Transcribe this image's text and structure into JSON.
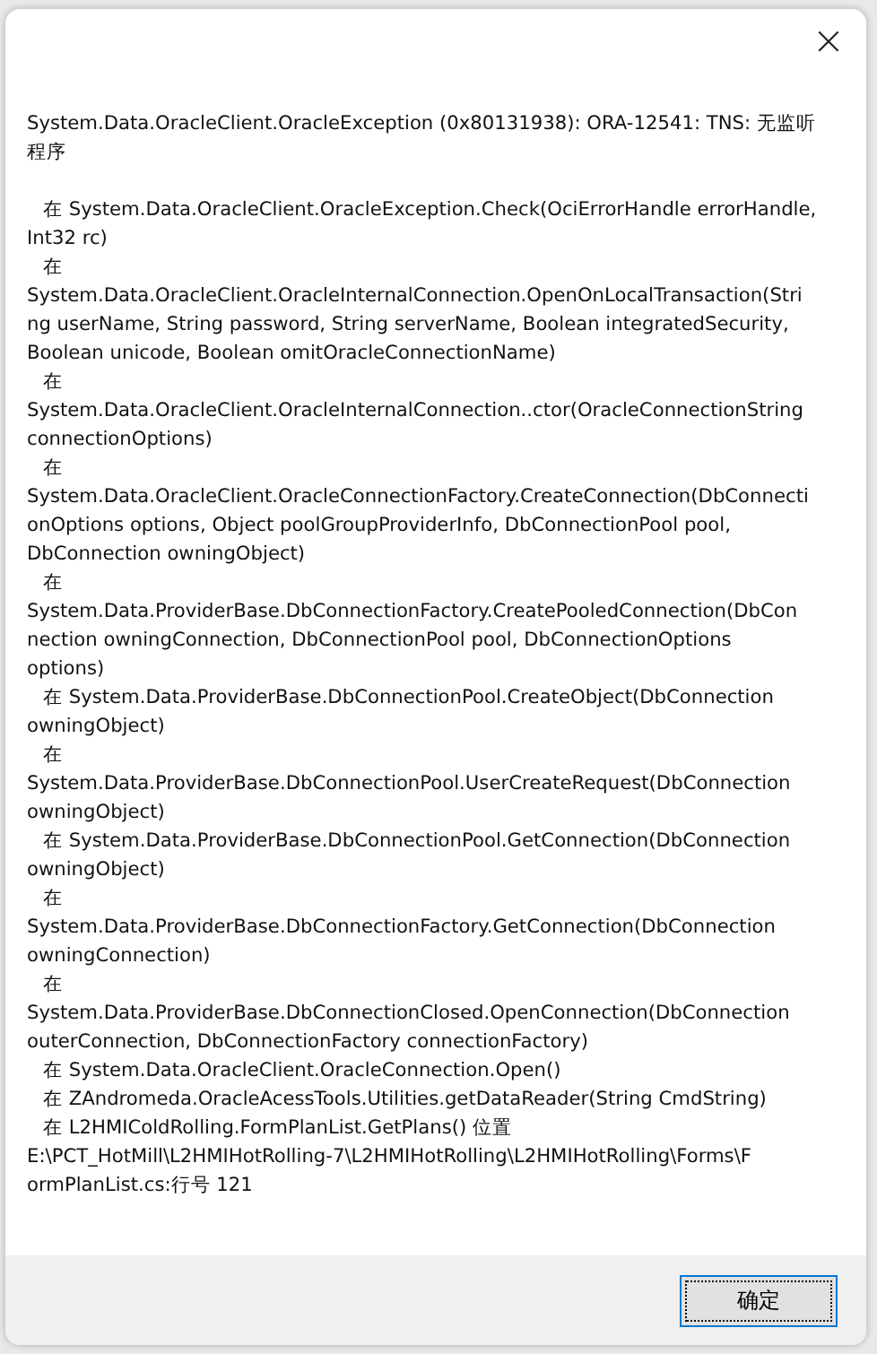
{
  "dialog": {
    "close_label": "×",
    "header_lines": [
      "System.Data.OracleClient.OracleException (0x80131938): ORA-12541: TNS: 无监听",
      "程序"
    ],
    "frames": [
      {
        "lines": [
          "在 System.Data.OracleClient.OracleException.Check(OciErrorHandle errorHandle,",
          "Int32 rc)"
        ]
      },
      {
        "lines": [
          "在",
          "System.Data.OracleClient.OracleInternalConnection.OpenOnLocalTransaction(Stri",
          "ng userName, String password, String serverName, Boolean integratedSecurity,",
          "Boolean unicode, Boolean omitOracleConnectionName)"
        ]
      },
      {
        "lines": [
          "在",
          "System.Data.OracleClient.OracleInternalConnection..ctor(OracleConnectionString",
          "connectionOptions)"
        ]
      },
      {
        "lines": [
          "在",
          "System.Data.OracleClient.OracleConnectionFactory.CreateConnection(DbConnecti",
          "onOptions options, Object poolGroupProviderInfo, DbConnectionPool pool,",
          "DbConnection owningObject)"
        ]
      },
      {
        "lines": [
          "在",
          "System.Data.ProviderBase.DbConnectionFactory.CreatePooledConnection(DbCon",
          "nection owningConnection, DbConnectionPool pool, DbConnectionOptions",
          "options)"
        ]
      },
      {
        "lines": [
          "在 System.Data.ProviderBase.DbConnectionPool.CreateObject(DbConnection",
          "owningObject)"
        ]
      },
      {
        "lines": [
          "在",
          "System.Data.ProviderBase.DbConnectionPool.UserCreateRequest(DbConnection",
          "owningObject)"
        ]
      },
      {
        "lines": [
          "在 System.Data.ProviderBase.DbConnectionPool.GetConnection(DbConnection",
          "owningObject)"
        ]
      },
      {
        "lines": [
          "在",
          "System.Data.ProviderBase.DbConnectionFactory.GetConnection(DbConnection",
          "owningConnection)"
        ]
      },
      {
        "lines": [
          "在",
          "System.Data.ProviderBase.DbConnectionClosed.OpenConnection(DbConnection",
          "outerConnection, DbConnectionFactory connectionFactory)"
        ]
      },
      {
        "lines": [
          "在 System.Data.OracleClient.OracleConnection.Open()"
        ]
      },
      {
        "lines": [
          "在 ZAndromeda.OracleAcessTools.Utilities.getDataReader(String CmdString)"
        ]
      },
      {
        "lines": [
          "在 L2HMIColdRolling.FormPlanList.GetPlans() 位置",
          "E:\\PCT_HotMill\\L2HMIHotRolling-7\\L2HMIHotRolling\\L2HMIHotRolling\\Forms\\F",
          "ormPlanList.cs:行号 121"
        ]
      }
    ],
    "ok_button": "确定"
  }
}
